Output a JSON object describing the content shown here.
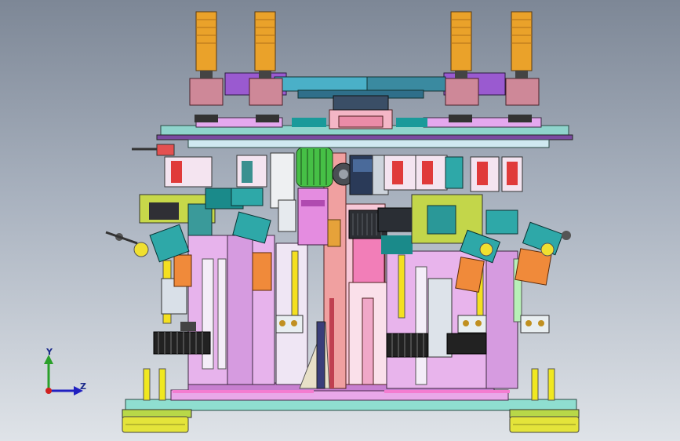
{
  "triad": {
    "x_label": "",
    "y_label": "Y",
    "z_label": "Z"
  },
  "colors": {
    "background_top": "#7d8796",
    "background_bottom": "#dfe3e8",
    "motor_gold": "#e8a52a",
    "frame_magenta": "#d890e0",
    "base_plate": "#7fd6c8",
    "spring_yellow": "#e8e030",
    "cylinder_orange": "#f08838",
    "servo_teal": "#2aa6a6",
    "gear_green": "#44c044",
    "motor_dark": "#2a2e34",
    "axis_y": "#2aa02a",
    "axis_z": "#2020c0",
    "axis_x": "#d02020"
  },
  "icons": [
    "coordinate-triad-icon"
  ]
}
